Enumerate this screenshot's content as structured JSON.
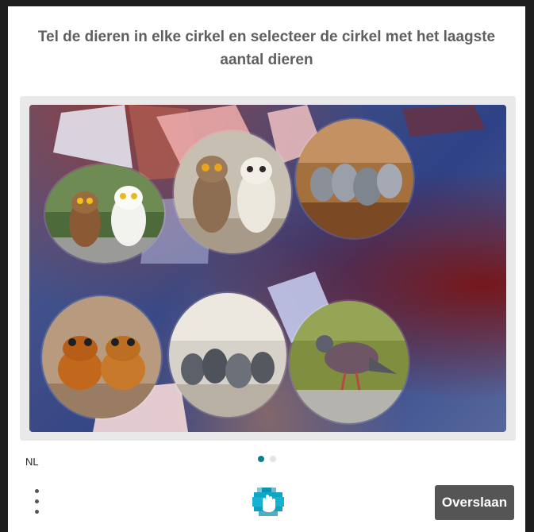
{
  "prompt": "Tel de dieren in elke cirkel en selecteer de cirkel met het laagste aantal dieren",
  "circles": [
    {
      "id": "owls-left",
      "depicts": "two owls"
    },
    {
      "id": "owls-middle",
      "depicts": "two owls"
    },
    {
      "id": "pigeons-top-right",
      "depicts": "pigeons"
    },
    {
      "id": "frogs",
      "depicts": "two frogs"
    },
    {
      "id": "pigeons-bottom-middle",
      "depicts": "pigeons"
    },
    {
      "id": "pigeon-single",
      "depicts": "one pigeon"
    }
  ],
  "footer": {
    "language": "NL",
    "page_indicator": {
      "current": 1,
      "total": 2
    },
    "skip_label": "Overslaan",
    "menu_icon": "vertical-ellipsis-icon",
    "logo_icon": "hcaptcha-hand-logo-icon"
  },
  "colors": {
    "button_bg": "#555555",
    "dot_active": "#0a7f8f",
    "dot_inactive": "#e4e4e4",
    "prompt_text": "#5f5f5f"
  }
}
